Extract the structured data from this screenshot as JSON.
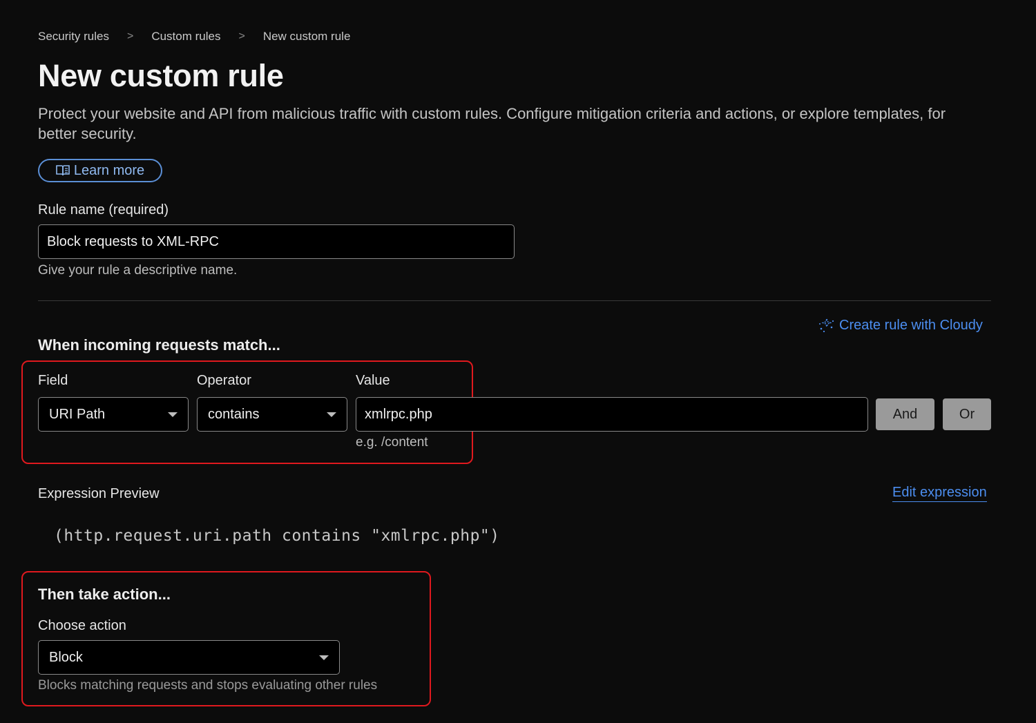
{
  "breadcrumb": {
    "items": [
      "Security rules",
      "Custom rules",
      "New custom rule"
    ],
    "separator": ">"
  },
  "page": {
    "title": "New custom rule",
    "description": "Protect your website and API from malicious traffic with custom rules. Configure mitigation criteria and actions, or explore templates, for better security.",
    "learn_more_label": "Learn more"
  },
  "rule_name": {
    "label": "Rule name (required)",
    "value": "Block requests to XML-RPC",
    "hint": "Give your rule a descriptive name."
  },
  "match": {
    "title": "When incoming requests match...",
    "cloudy_link": "Create rule with Cloudy",
    "field_label": "Field",
    "field_value": "URI Path",
    "operator_label": "Operator",
    "operator_value": "contains",
    "value_label": "Value",
    "value_input": "xmlrpc.php",
    "value_hint": "e.g. /content",
    "and_label": "And",
    "or_label": "Or"
  },
  "expression": {
    "label": "Expression Preview",
    "edit_link": "Edit expression",
    "text": "(http.request.uri.path contains \"xmlrpc.php\")"
  },
  "action": {
    "title": "Then take action...",
    "label": "Choose action",
    "value": "Block",
    "hint": "Blocks matching requests and stops evaluating other rules"
  },
  "colors": {
    "background": "#0c0c0c",
    "link": "#4c8ef0",
    "highlight": "#e0191e",
    "button_gray": "#9a9a9a"
  }
}
